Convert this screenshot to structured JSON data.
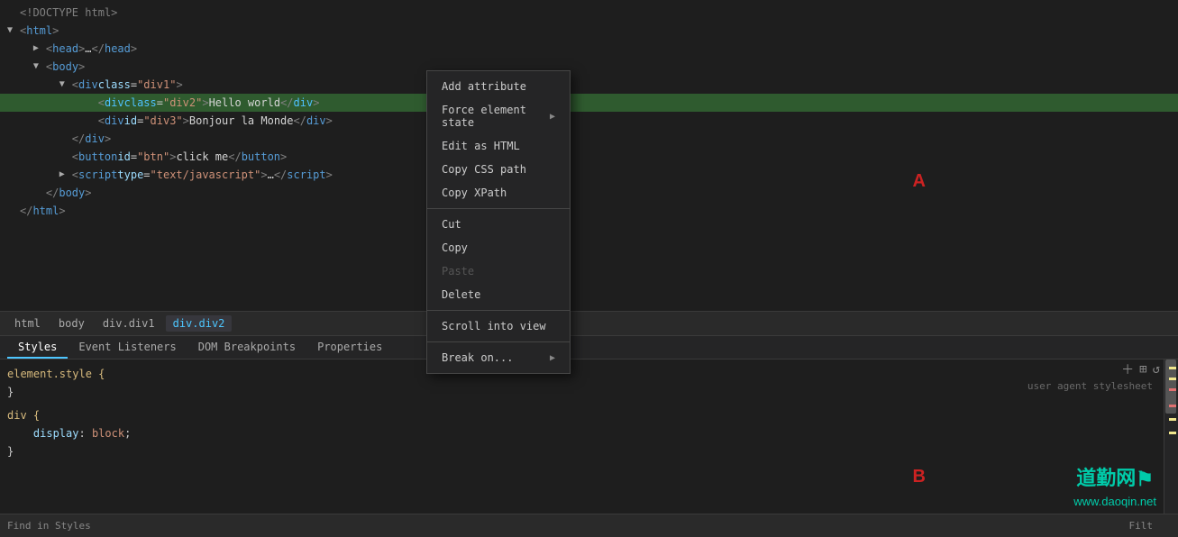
{
  "editor": {
    "lines": [
      {
        "id": "line-doctype",
        "indent": 0,
        "triangle": "",
        "content_html": "<span class='c-doctype'>&lt;!DOCTYPE html&gt;</span>",
        "highlighted": false
      },
      {
        "id": "line-html-open",
        "indent": 0,
        "triangle": "▼",
        "content_html": "<span class='c-bracket'>&lt;</span><span class='c-tag'>html</span><span class='c-bracket'>&gt;</span>",
        "highlighted": false
      },
      {
        "id": "line-head",
        "indent": 1,
        "triangle": "▶",
        "content_html": "<span class='c-bracket'>&lt;</span><span class='c-tag'>head</span><span class='c-bracket'>&gt;</span><span class='c-text'>…</span><span class='c-bracket'>&lt;/</span><span class='c-tag'>head</span><span class='c-bracket'>&gt;</span>",
        "highlighted": false
      },
      {
        "id": "line-body",
        "indent": 1,
        "triangle": "▼",
        "content_html": "<span class='c-bracket'>&lt;</span><span class='c-tag'>body</span><span class='c-bracket'>&gt;</span>",
        "highlighted": false
      },
      {
        "id": "line-div1",
        "indent": 2,
        "triangle": "▼",
        "content_html": "<span class='c-bracket'>&lt;</span><span class='c-tag'>div</span> <span class='c-attr'>class</span><span class='c-eq'>=</span><span class='c-val'>\"div1\"</span><span class='c-bracket'>&gt;</span>",
        "highlighted": false
      },
      {
        "id": "line-div2",
        "indent": 3,
        "triangle": "",
        "content_html": "<span class='c-bracket'>&lt;</span><span class='c-highlight-tag'>div</span> <span class='c-highlight-text'>class</span><span class='c-eq'>=</span><span class='c-orange'>\"div2\"</span><span class='c-bracket'>&gt;</span><span class='c-text'>Hello world</span><span class='c-bracket'>&lt;/</span><span class='c-highlight-tag'>div</span><span class='c-bracket'>&gt;</span>",
        "highlighted": true
      },
      {
        "id": "line-div3",
        "indent": 3,
        "triangle": "",
        "content_html": "<span class='c-bracket'>&lt;</span><span class='c-tag'>div</span> <span class='c-attr'>id</span><span class='c-eq'>=</span><span class='c-val'>\"div3\"</span><span class='c-bracket'>&gt;</span><span class='c-text'>Bonjour la Monde</span><span class='c-bracket'>&lt;/</span><span class='c-tag'>div</span><span class='c-bracket'>&gt;</span>",
        "highlighted": false
      },
      {
        "id": "line-divclose",
        "indent": 2,
        "triangle": "",
        "content_html": "<span class='c-bracket'>&lt;/</span><span class='c-tag'>div</span><span class='c-bracket'>&gt;</span>",
        "highlighted": false
      },
      {
        "id": "line-button",
        "indent": 2,
        "triangle": "",
        "content_html": "<span class='c-bracket'>&lt;</span><span class='c-tag'>button</span> <span class='c-attr'>id</span><span class='c-eq'>=</span><span class='c-val'>\"btn\"</span><span class='c-bracket'>&gt;</span><span class='c-text'>click me</span><span class='c-bracket'>&lt;/</span><span class='c-tag'>button</span><span class='c-bracket'>&gt;</span>",
        "highlighted": false
      },
      {
        "id": "line-script",
        "indent": 2,
        "triangle": "▶",
        "content_html": "<span class='c-bracket'>&lt;</span><span class='c-tag'>script</span> <span class='c-attr'>type</span><span class='c-eq'>=</span><span class='c-val'>\"text/javascript\"</span><span class='c-bracket'>&gt;</span><span class='c-text'>…</span><span class='c-bracket'>&lt;/</span><span class='c-tag'>script</span><span class='c-bracket'>&gt;</span>",
        "highlighted": false
      },
      {
        "id": "line-bodyclose",
        "indent": 1,
        "triangle": "",
        "content_html": "<span class='c-bracket'>&lt;/</span><span class='c-tag'>body</span><span class='c-bracket'>&gt;</span>",
        "highlighted": false
      },
      {
        "id": "line-htmlclose",
        "indent": 0,
        "triangle": "",
        "content_html": "<span class='c-bracket'>&lt;/</span><span class='c-tag'>html</span><span class='c-bracket'>&gt;</span>",
        "highlighted": false
      }
    ]
  },
  "breadcrumb": {
    "items": [
      {
        "label": "html",
        "active": false
      },
      {
        "label": "body",
        "active": false
      },
      {
        "label": "div.div1",
        "active": false
      },
      {
        "label": "div.div2",
        "active": true
      }
    ]
  },
  "tabs": {
    "items": [
      {
        "label": "Styles",
        "active": true
      },
      {
        "label": "Event Listeners",
        "active": false
      },
      {
        "label": "DOM Breakpoints",
        "active": false
      },
      {
        "label": "Properties",
        "active": false
      }
    ]
  },
  "styles_panel": {
    "rules": [
      {
        "selector": "element.style {",
        "props": [],
        "close": "}"
      },
      {
        "selector": "div {",
        "props": [
          {
            "prop": "display",
            "val": "block"
          }
        ],
        "close": "}"
      }
    ],
    "ua_label": "user agent stylesheet"
  },
  "context_menu": {
    "items": [
      {
        "label": "Add attribute",
        "disabled": false,
        "has_arrow": false,
        "separator_after": false
      },
      {
        "label": "Force element state",
        "disabled": false,
        "has_arrow": true,
        "separator_after": false
      },
      {
        "label": "Edit as HTML",
        "disabled": false,
        "has_arrow": false,
        "separator_after": false
      },
      {
        "label": "Copy CSS path",
        "disabled": false,
        "has_arrow": false,
        "separator_after": false
      },
      {
        "label": "Copy XPath",
        "disabled": false,
        "has_arrow": false,
        "separator_after": true
      },
      {
        "label": "Cut",
        "disabled": false,
        "has_arrow": false,
        "separator_after": false
      },
      {
        "label": "Copy",
        "disabled": false,
        "has_arrow": false,
        "separator_after": false
      },
      {
        "label": "Paste",
        "disabled": true,
        "has_arrow": false,
        "separator_after": false
      },
      {
        "label": "Delete",
        "disabled": false,
        "has_arrow": false,
        "separator_after": true
      },
      {
        "label": "Scroll into view",
        "disabled": false,
        "has_arrow": false,
        "separator_after": true
      },
      {
        "label": "Break on...",
        "disabled": false,
        "has_arrow": true,
        "separator_after": false
      }
    ]
  },
  "region_labels": {
    "A": "A",
    "B": "B"
  },
  "watermark": {
    "line1": "道勤网",
    "line2": "www.daoqin.net"
  },
  "status_bar": {
    "find_label": "Find in Styles",
    "filter_label": "Filt"
  }
}
